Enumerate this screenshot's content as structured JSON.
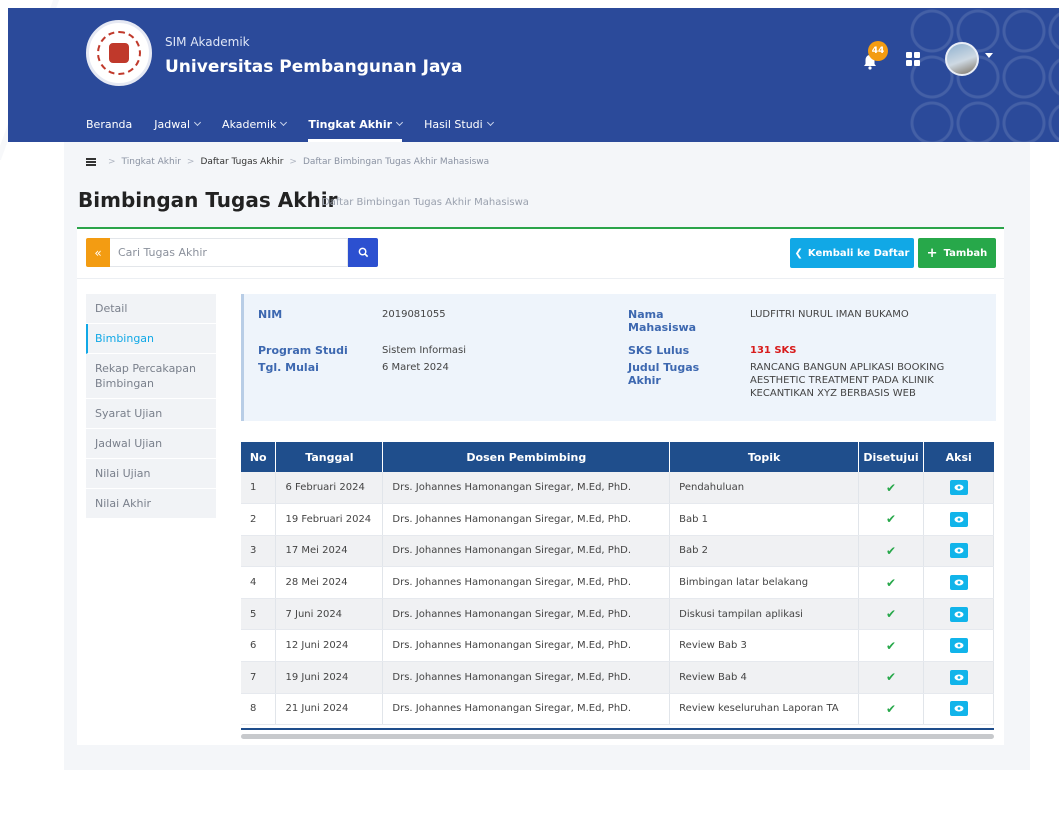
{
  "header": {
    "app_sub": "SIM Akademik",
    "app_title": "Universitas Pembangunan Jaya",
    "notification_count": "44",
    "brand_color": "#2b4a9a"
  },
  "nav": {
    "items": [
      {
        "label": "Beranda"
      },
      {
        "label": "Jadwal"
      },
      {
        "label": "Akademik"
      },
      {
        "label": "Tingkat Akhir"
      },
      {
        "label": "Hasil Studi"
      }
    ]
  },
  "breadcrumb": {
    "items": [
      "Tingkat Akhir",
      "Daftar Tugas Akhir",
      "Daftar Bimbingan Tugas Akhir Mahasiswa"
    ]
  },
  "page": {
    "title": "Bimbingan Tugas Akhir",
    "subtitle": "Daftar Bimbingan Tugas Akhir Mahasiswa"
  },
  "toolbar": {
    "collapse_label": "«",
    "search_placeholder": "Cari Tugas Akhir",
    "back_label": "Kembali ke Daftar",
    "add_label": "Tambah"
  },
  "side_menu": {
    "items": [
      {
        "label": "Detail"
      },
      {
        "label": "Bimbingan"
      },
      {
        "label": "Rekap Percakapan Bimbingan"
      },
      {
        "label": "Syarat Ujian"
      },
      {
        "label": "Jadwal Ujian"
      },
      {
        "label": "Nilai Ujian"
      },
      {
        "label": "Nilai Akhir"
      }
    ]
  },
  "info": {
    "nim_label": "NIM",
    "nim_value": "2019081055",
    "program_label": "Program Studi",
    "program_value": "Sistem Informasi",
    "tgl_label": "Tgl. Mulai",
    "tgl_value": "6 Maret 2024",
    "nama_label": "Nama Mahasiswa",
    "nama_value": "LUDFITRI NURUL IMAN BUKAMO",
    "sks_label": "SKS Lulus",
    "sks_value": "131 SKS",
    "judul_label": "Judul Tugas Akhir",
    "judul_value": "RANCANG BANGUN APLIKASI BOOKING AESTHETIC TREATMENT PADA KLINIK KECANTIKAN XYZ BERBASIS WEB"
  },
  "table": {
    "headers": [
      "No",
      "Tanggal",
      "Dosen Pembimbing",
      "Topik",
      "Disetujui",
      "Aksi"
    ],
    "rows": [
      {
        "no": "1",
        "tanggal": "6 Februari 2024",
        "dosen": "Drs. Johannes Hamonangan Siregar, M.Ed, PhD.",
        "topik": "Pendahuluan"
      },
      {
        "no": "2",
        "tanggal": "19 Februari 2024",
        "dosen": "Drs. Johannes Hamonangan Siregar, M.Ed, PhD.",
        "topik": "Bab 1"
      },
      {
        "no": "3",
        "tanggal": "17 Mei 2024",
        "dosen": "Drs. Johannes Hamonangan Siregar, M.Ed, PhD.",
        "topik": "Bab 2"
      },
      {
        "no": "4",
        "tanggal": "28 Mei 2024",
        "dosen": "Drs. Johannes Hamonangan Siregar, M.Ed, PhD.",
        "topik": "Bimbingan latar belakang"
      },
      {
        "no": "5",
        "tanggal": "7 Juni 2024",
        "dosen": "Drs. Johannes Hamonangan Siregar, M.Ed, PhD.",
        "topik": "Diskusi tampilan aplikasi"
      },
      {
        "no": "6",
        "tanggal": "12 Juni 2024",
        "dosen": "Drs. Johannes Hamonangan Siregar, M.Ed, PhD.",
        "topik": "Review Bab 3"
      },
      {
        "no": "7",
        "tanggal": "19 Juni 2024",
        "dosen": "Drs. Johannes Hamonangan Siregar, M.Ed, PhD.",
        "topik": "Review Bab 4"
      },
      {
        "no": "8",
        "tanggal": "21 Juni 2024",
        "dosen": "Drs. Johannes Hamonangan Siregar, M.Ed, PhD.",
        "topik": "Review keseluruhan Laporan TA"
      }
    ]
  }
}
